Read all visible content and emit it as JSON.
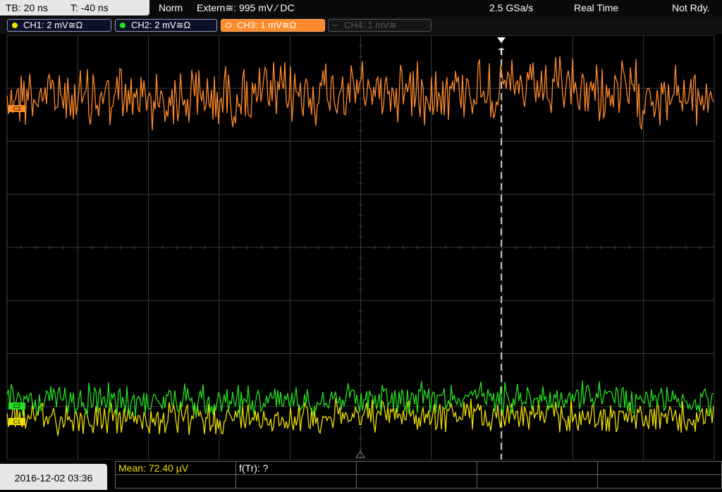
{
  "topbar": {
    "timebase": "TB: 20 ns",
    "trigger_offset": "T: -40 ns",
    "mode": "Norm",
    "trigger_source": "Extern≅: 995 mV ⁄ DC",
    "sample_rate": "2.5 GSa/s",
    "acquisition": "Real Time",
    "state": "Not Rdy."
  },
  "channels": [
    {
      "label": "CH1: 2 mV≅Ω",
      "color": "#f0e000",
      "state": "on"
    },
    {
      "label": "CH2: 2 mV≅Ω",
      "color": "#22e022",
      "state": "on"
    },
    {
      "label": "CH3: 1 mV≅Ω",
      "color": "#ff8a2a",
      "state": "selected"
    },
    {
      "label": "CH4: 1 mV≅",
      "color": "#555555",
      "state": "off"
    }
  ],
  "markers": {
    "ch3": "C3",
    "ch2": "C2",
    "ch1": "C1",
    "trigger": "T"
  },
  "colors": {
    "grid": "#3a3a3a",
    "ch1": "#f0e000",
    "ch2": "#22e022",
    "ch3": "#ff8a2a"
  },
  "waveforms": {
    "ch3": {
      "level_div": 2.9,
      "noise_div": 0.55
    },
    "ch2": {
      "level_div": -2.85,
      "noise_div": 0.28
    },
    "ch1": {
      "level_div": -3.2,
      "noise_div": 0.28
    }
  },
  "bottombar": {
    "datetime": "2016-12-02 03:36",
    "mean": "Mean: 72.40 µV",
    "ftr": "f(Tr): ?"
  }
}
